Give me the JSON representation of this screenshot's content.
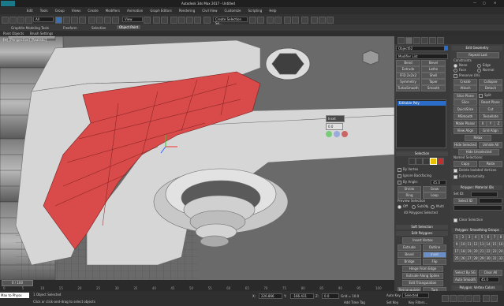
{
  "title": "Autodesk 3ds Max 2017 - Untitled",
  "menu": [
    "Edit",
    "Tools",
    "Group",
    "Views",
    "Create",
    "Modifiers",
    "Animation",
    "Graph Editors",
    "Rendering",
    "Civil View",
    "Customize",
    "Scripting",
    "Help"
  ],
  "toolbar": {
    "filter_value": "All",
    "view_value": "View",
    "selection_set": "Create Selection Se..."
  },
  "ribbon": {
    "tabs": [
      "Graphite Modeling Tools",
      "Freeform",
      "Selection",
      "Object Paint"
    ],
    "sub": [
      "Paint Objects",
      "Brush Settings"
    ]
  },
  "viewport": {
    "label": "[+] [Perspective] [Realistic]",
    "caddy_title": "Inset",
    "caddy_value": "0.0"
  },
  "command_panel": {
    "object_name": "Object62",
    "modifier_list": "Modifier List",
    "modifiers_grid": [
      "Bend",
      "Bevel",
      "Extrude",
      "Lathe",
      "FFD 2x2x2",
      "Shell",
      "Symmetry",
      "Taper",
      "TurboSmooth",
      "Smooth"
    ],
    "stack_item": "Editable Poly",
    "selection": {
      "header": "Selection",
      "by_vertex": "By Vertex",
      "ignore_backfacing": "Ignore Backfacing",
      "by_angle": "By Angle:",
      "by_angle_value": "45.0",
      "shrink": "Shrink",
      "grow": "Grow",
      "ring": "Ring",
      "loop": "Loop",
      "preview": "Preview Selection",
      "off": "Off",
      "subobj": "SubObj",
      "multi": "Multi",
      "status": "40 Polygons Selected"
    },
    "soft_selection": "Soft Selection",
    "edit_polygons": {
      "header": "Edit Polygons",
      "insert_vertex": "Insert Vertex",
      "extrude": "Extrude",
      "outline": "Outline",
      "bevel": "Bevel",
      "inset": "Inset",
      "bridge": "Bridge",
      "flip": "Flip",
      "hinge": "Hinge From Edge",
      "extrude_spline": "Extrude Along Spline",
      "edit_tri": "Edit Triangulation",
      "retriangulate": "Retriangulate",
      "turn": "Turn"
    }
  },
  "edit_geometry": {
    "header": "Edit Geometry",
    "repeat_last": "Repeat Last",
    "constraints": "Constraints",
    "none": "None",
    "edge": "Edge",
    "face": "Face",
    "normal": "Normal",
    "preserve_uvs": "Preserve UVs",
    "create": "Create",
    "collapse": "Collapse",
    "attach": "Attach",
    "detach": "Detach",
    "slice_plane": "Slice Plane",
    "split": "Split",
    "slice": "Slice",
    "reset_plane": "Reset Plane",
    "quickslice": "QuickSlice",
    "cut": "Cut",
    "msmooth": "MSmooth",
    "tessellate": "Tessellate",
    "make_planar": "Make Planar",
    "x": "X",
    "y": "Y",
    "z": "Z",
    "view_align": "View Align",
    "grid_align": "Grid Align",
    "relax": "Relax",
    "hide_selected": "Hide Selected",
    "unhide_all": "Unhide All",
    "hide_unselected": "Hide Unselected",
    "named_selections": "Named Selections:",
    "copy": "Copy",
    "paste": "Paste",
    "delete_isolated": "Delete Isolated Vertices",
    "full_interactivity": "Full Interactivity"
  },
  "material_ids": {
    "header": "Polygon: Material IDs",
    "set_id": "Set ID:",
    "select_id": "Select ID",
    "clear_selection": "Clear Selection"
  },
  "smoothing": {
    "header": "Polygon: Smoothing Groups",
    "groups": [
      "1",
      "2",
      "3",
      "4",
      "5",
      "6",
      "7",
      "8",
      "9",
      "10",
      "11",
      "12",
      "13",
      "14",
      "15",
      "16",
      "17",
      "18",
      "19",
      "20",
      "21",
      "22",
      "23",
      "24",
      "25",
      "26",
      "27",
      "28",
      "29",
      "30",
      "31",
      "32"
    ],
    "select_by_sg": "Select By SG",
    "clear_all": "Clear All",
    "auto_smooth": "Auto Smooth",
    "auto_smooth_value": "45.0"
  },
  "vertex_colors": {
    "header": "Polygon: Vertex Colors",
    "color": "Color:"
  },
  "timeline": {
    "frame": "0 / 100",
    "ticks": [
      "0",
      "5",
      "10",
      "15",
      "20",
      "25",
      "30",
      "35",
      "40",
      "45",
      "50",
      "55",
      "60",
      "65",
      "70",
      "75",
      "80",
      "85",
      "90",
      "95",
      "100"
    ]
  },
  "status": {
    "maxscript": "Max to Physx",
    "selected": "1 Object Selected",
    "prompt": "Click or click-and-drag to select objects",
    "x_label": "X:",
    "x_value": "226.866",
    "y_label": "Y:",
    "y_value": "-166.431",
    "z_label": "Z:",
    "z_value": "0.0",
    "grid": "Grid = 10.0",
    "add_time_tag": "Add Time Tag",
    "auto_key": "Auto Key",
    "set_key": "Set Key",
    "selected_dd": "Selected",
    "key_filters": "Key Filters..."
  },
  "colors": {
    "selection_red": "#d94a4a",
    "viewport_bg": "#6b6b6b",
    "accent": "#2a6cc8"
  }
}
